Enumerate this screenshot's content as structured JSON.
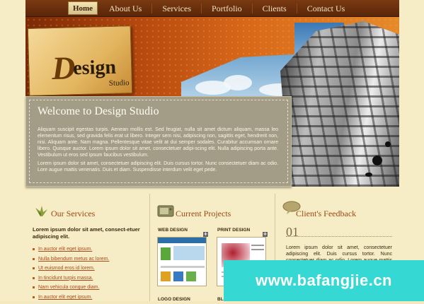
{
  "nav": {
    "home": "Home",
    "items": [
      "About Us",
      "Services",
      "Portfolio",
      "Clients",
      "Contact Us"
    ]
  },
  "logo": {
    "d": "D",
    "esign": "esign",
    "studio": "Studio"
  },
  "welcome": {
    "title": "Welcome to Design Studio",
    "para1": "Aliquam suscipit egestas turpis. Aenean mollis est. Sed feugiat, nulla sit amet dictum aliquam, massa leo elementum risus, sed gravida felis erat ut libero. Integer sem nisi, adipiscing non, sagittis eget, hendrerit non, nisi. Aliquam ante. Nam magna. Pellentesque vitae velit at dui semper sodales. Curabitur accumsan ornare libero. Quisque auctor. Lorem ipsum dolor sit amet, consectetuer adipi-scing elit. Nulla adipiscing porta ante. Vestibulum ut eros sed ipsum faucibus vestibulum.",
    "para2": "Lorem ipsum dolor sit amet, consectetuer adipiscing elit. Duis cursus tortor. Nunc consectetuer diam ac odio. Lore augue mattis venenatis. Duis et diam. Suspendisse interdum velit eget pede."
  },
  "services": {
    "title": "Our Services",
    "intro": "Lorem ipsum dolor sit amet, consect-etuer adipiscing elit.",
    "items": [
      "In auctor elit eget ipsum.",
      "Nulla bibendum metus ac lorem.",
      "Ut euismod eros id lorem.",
      "In tincidunt turpis massa.",
      "Nam vehicula congue diam.",
      "In auctor elit eget ipsum."
    ]
  },
  "projects": {
    "title": "Current Projects",
    "labels": [
      "WEB DESIGN",
      "PRINT DESIGN",
      "LOGO DESIGN",
      "BLOG DESIGN"
    ],
    "plus": "+"
  },
  "feedback": {
    "title": "Client's Feedback",
    "number": "01",
    "text": "Lorem ipsum dolor sit amet, consectetuer adipiscing elit. Duis cursus tortor. Nunc consectetuer diam ac odio. Lorem augue mattis venenatis."
  },
  "watermark": "www.bafangjie.cn",
  "colors": {
    "nav": "#6a2e0c",
    "accent": "#9a4a12",
    "panel": "#a39c86",
    "watermark": "#36d8d4"
  }
}
